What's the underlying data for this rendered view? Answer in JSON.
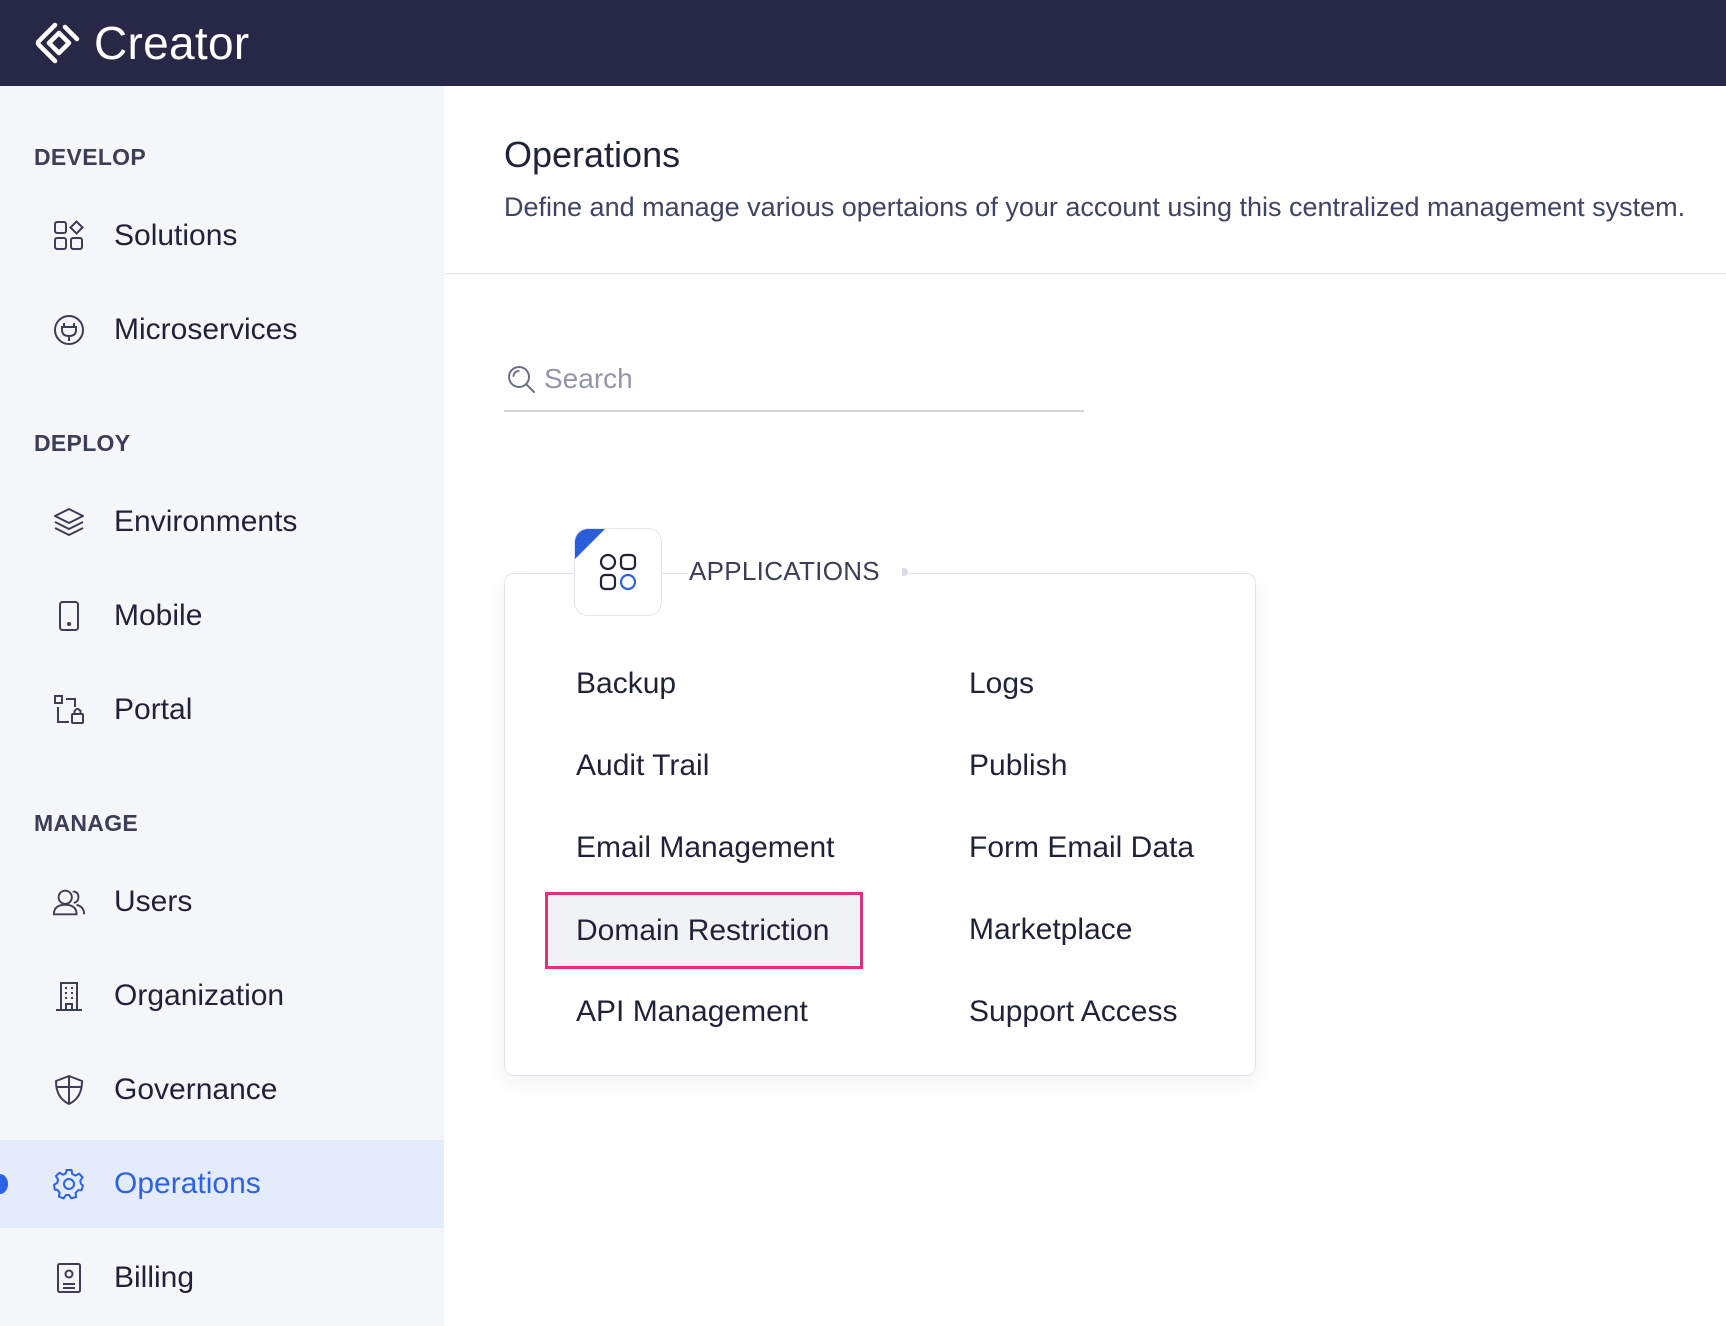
{
  "app": {
    "title": "Creator"
  },
  "sidebar": {
    "sections": [
      {
        "title": "DEVELOP",
        "items": [
          {
            "label": "Solutions",
            "icon": "grid-shapes-icon"
          },
          {
            "label": "Microservices",
            "icon": "plug-icon"
          }
        ]
      },
      {
        "title": "DEPLOY",
        "items": [
          {
            "label": "Environments",
            "icon": "layers-icon"
          },
          {
            "label": "Mobile",
            "icon": "mobile-icon"
          },
          {
            "label": "Portal",
            "icon": "portal-icon"
          }
        ]
      },
      {
        "title": "MANAGE",
        "items": [
          {
            "label": "Users",
            "icon": "users-icon"
          },
          {
            "label": "Organization",
            "icon": "building-icon"
          },
          {
            "label": "Governance",
            "icon": "shield-icon"
          },
          {
            "label": "Operations",
            "icon": "gear-icon",
            "active": true
          },
          {
            "label": "Billing",
            "icon": "receipt-icon"
          }
        ]
      }
    ]
  },
  "main": {
    "title": "Operations",
    "description": "Define and manage various opertaions of your account using this centralized management system.",
    "search": {
      "placeholder": "Search",
      "value": ""
    },
    "card": {
      "title": "APPLICATIONS",
      "icon": "apps-icon",
      "links": [
        {
          "label": "Backup"
        },
        {
          "label": "Logs"
        },
        {
          "label": "Audit Trail"
        },
        {
          "label": "Publish"
        },
        {
          "label": "Email Management"
        },
        {
          "label": "Form Email Data"
        },
        {
          "label": "Domain Restriction",
          "highlighted": true
        },
        {
          "label": "Marketplace"
        },
        {
          "label": "API Management"
        },
        {
          "label": "Support Access"
        }
      ]
    }
  },
  "colors": {
    "topbar": "#262846",
    "sidebar_bg": "#f5f6fa",
    "active_bg": "#e4ebfb",
    "accent": "#2d62e6",
    "highlight_border": "#e0347a"
  }
}
